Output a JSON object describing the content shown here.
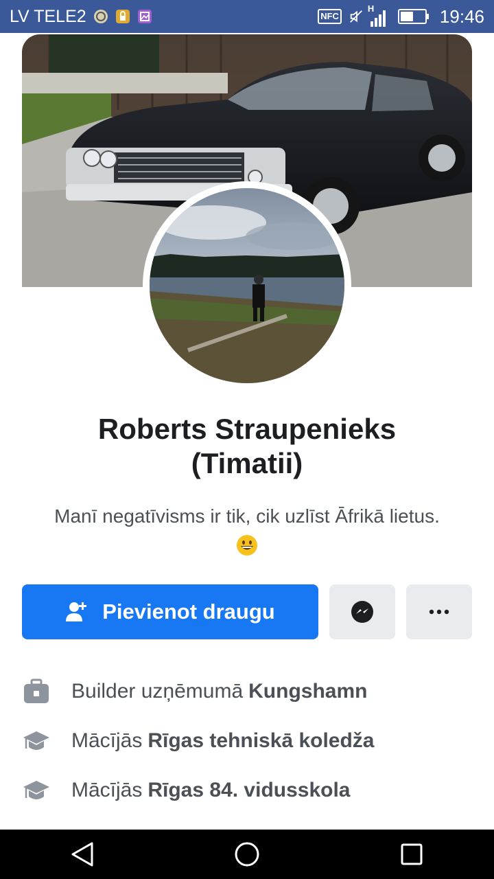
{
  "status_bar": {
    "carrier": "LV TELE2",
    "nfc": "NFC",
    "network": "H",
    "time": "19:46"
  },
  "profile": {
    "name_line1": "Roberts Straupenieks",
    "name_line2": "(Timatii)",
    "bio": "Manī negatīvisms ir tik, cik uzlīst Āfrikā lietus."
  },
  "actions": {
    "add_friend_label": "Pievienot draugu",
    "add_friend_icon": "add-person-icon",
    "messenger_icon": "messenger-icon",
    "more_icon": "more-dots-icon"
  },
  "info": [
    {
      "prefix": "Builder uzņēmumā",
      "value": "Kungshamn",
      "icon": "briefcase-icon"
    },
    {
      "prefix": "Mācījās",
      "value": "Rīgas tehniskā koledža",
      "icon": "graduation-cap-icon"
    },
    {
      "prefix": "Mācījās",
      "value": "Rīgas 84. vidusskola",
      "icon": "graduation-cap-icon"
    }
  ],
  "colors": {
    "status_bar": "#3b5998",
    "primary_button": "#1877f2",
    "secondary_button": "#e9ebee"
  }
}
